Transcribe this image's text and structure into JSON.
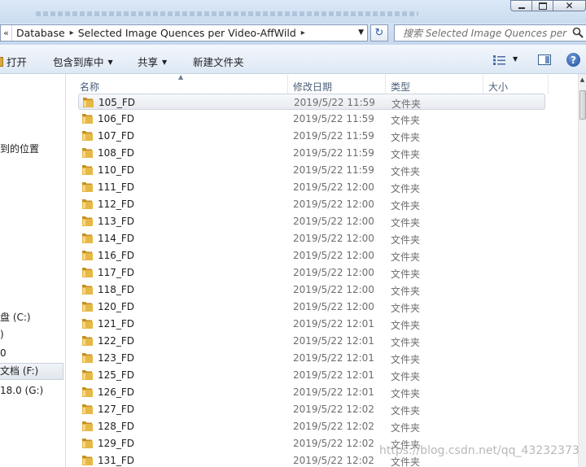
{
  "window": {
    "close_glyph": "✕"
  },
  "address_bar": {
    "back_glyph": "«",
    "crumbs": [
      "Database",
      "Selected Image Quences per Video-AffWild"
    ],
    "separator": "▸",
    "dropdown_glyph": "▼",
    "refresh_glyph": "↻"
  },
  "search": {
    "placeholder": "搜索 Selected Image Quences per Video-AffWild"
  },
  "toolbar": {
    "open": "打开",
    "include_in_library": "包含到库中",
    "share": "共享",
    "new_folder": "新建文件夹",
    "dropdown_arrow": "▼",
    "help": "?",
    "view_arrow": "▼"
  },
  "nav": {
    "items": [
      "到的位置",
      "盘 (C:)",
      ")",
      "0",
      "文档 (F:)",
      "18.0 (G:)"
    ],
    "selected_index": 4
  },
  "columns": {
    "name": "名称",
    "date": "修改日期",
    "type": "类型",
    "size": "大小",
    "sort_glyph": "▲"
  },
  "rows": [
    {
      "name": "105_FD",
      "date": "2019/5/22 11:59",
      "type": "文件夹"
    },
    {
      "name": "106_FD",
      "date": "2019/5/22 11:59",
      "type": "文件夹"
    },
    {
      "name": "107_FD",
      "date": "2019/5/22 11:59",
      "type": "文件夹"
    },
    {
      "name": "108_FD",
      "date": "2019/5/22 11:59",
      "type": "文件夹"
    },
    {
      "name": "110_FD",
      "date": "2019/5/22 11:59",
      "type": "文件夹"
    },
    {
      "name": "111_FD",
      "date": "2019/5/22 12:00",
      "type": "文件夹"
    },
    {
      "name": "112_FD",
      "date": "2019/5/22 12:00",
      "type": "文件夹"
    },
    {
      "name": "113_FD",
      "date": "2019/5/22 12:00",
      "type": "文件夹"
    },
    {
      "name": "114_FD",
      "date": "2019/5/22 12:00",
      "type": "文件夹"
    },
    {
      "name": "116_FD",
      "date": "2019/5/22 12:00",
      "type": "文件夹"
    },
    {
      "name": "117_FD",
      "date": "2019/5/22 12:00",
      "type": "文件夹"
    },
    {
      "name": "118_FD",
      "date": "2019/5/22 12:00",
      "type": "文件夹"
    },
    {
      "name": "120_FD",
      "date": "2019/5/22 12:00",
      "type": "文件夹"
    },
    {
      "name": "121_FD",
      "date": "2019/5/22 12:01",
      "type": "文件夹"
    },
    {
      "name": "122_FD",
      "date": "2019/5/22 12:01",
      "type": "文件夹"
    },
    {
      "name": "123_FD",
      "date": "2019/5/22 12:01",
      "type": "文件夹"
    },
    {
      "name": "125_FD",
      "date": "2019/5/22 12:01",
      "type": "文件夹"
    },
    {
      "name": "126_FD",
      "date": "2019/5/22 12:01",
      "type": "文件夹"
    },
    {
      "name": "127_FD",
      "date": "2019/5/22 12:02",
      "type": "文件夹"
    },
    {
      "name": "128_FD",
      "date": "2019/5/22 12:02",
      "type": "文件夹"
    },
    {
      "name": "129_FD",
      "date": "2019/5/22 12:02",
      "type": "文件夹"
    },
    {
      "name": "131_FD",
      "date": "2019/5/22 12:02",
      "type": "文件夹"
    }
  ],
  "selected_row_index": 0,
  "scrollbar": {
    "up_glyph": "▲"
  },
  "watermark": "https://blog.csdn.net/qq_43232373",
  "colors": {
    "folder": "#e6b845",
    "folder_dark": "#c58f1f",
    "header_text": "#4c607a",
    "meta_text": "#6d6d6d",
    "chrome": "#c9dcf1"
  }
}
